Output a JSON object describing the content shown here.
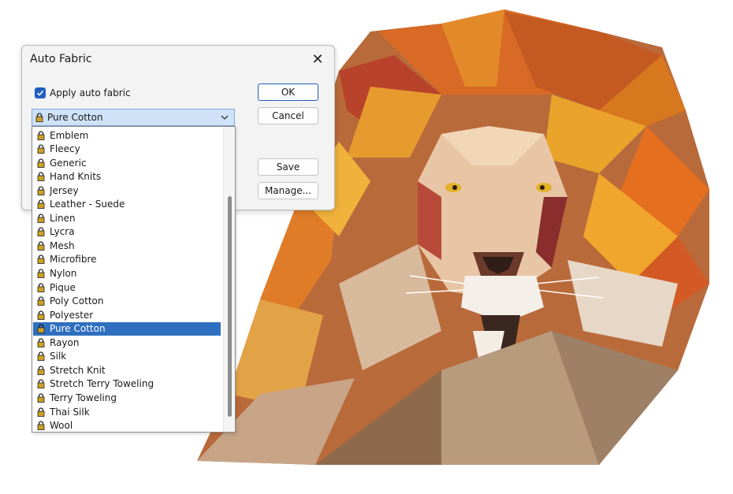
{
  "dialog": {
    "title": "Auto Fabric",
    "checkbox_label": "Apply auto fabric",
    "checked": true,
    "ok_label": "OK",
    "cancel_label": "Cancel",
    "save_label": "Save",
    "manage_label": "Manage...",
    "selected_fabric": "Pure Cotton",
    "close_icon": "close-icon"
  },
  "fabrics": [
    "Emblem",
    "Fleecy",
    "Generic",
    "Hand Knits",
    "Jersey",
    "Leather - Suede",
    "Linen",
    "Lycra",
    "Mesh",
    "Microfibre",
    "Nylon",
    "Pique",
    "Poly Cotton",
    "Polyester",
    "Pure Cotton",
    "Rayon",
    "Silk",
    "Stretch Knit",
    "Stretch Terry Toweling",
    "Terry Toweling",
    "Thai Silk",
    "Wool"
  ],
  "colors": {
    "accent": "#2f6fbf",
    "combo_bg": "#cfe2f7"
  }
}
